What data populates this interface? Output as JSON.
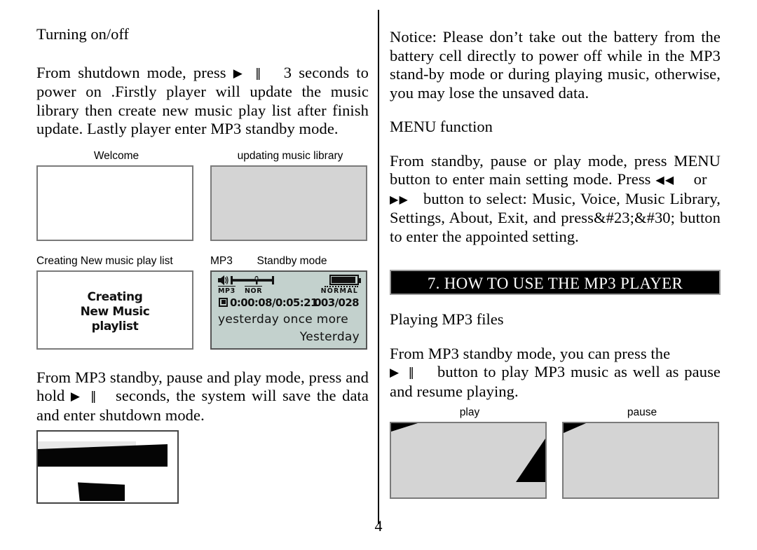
{
  "document": {
    "page_number": "4",
    "left_column": {
      "heading": "Turning on/off",
      "paragraph_1_part1": "From shutdown mode, press",
      "paragraph_1_glyph": "▶ ‖",
      "paragraph_1_part2": "3 seconds to power on .Firstly player will update the music library then create new   music play list after finish update. Lastly player enter MP3 standby mode.",
      "paragraph_2_part1": "From MP3 standby, pause and play mode, press and hold",
      "paragraph_2_glyph": "▶ ‖",
      "paragraph_2_part2": "seconds, the system will save the data and enter shutdown mode.",
      "figures": {
        "welcome_caption": "Welcome",
        "updating_caption": "updating music library",
        "creating_caption": "Creating New music play list",
        "standby_caption_left": "MP3",
        "standby_caption_right": "Standby mode",
        "creating_screen_line1": "Creating",
        "creating_screen_line2": "New Music",
        "creating_screen_line3": "playlist",
        "lcd": {
          "format_label": "MP3",
          "eq_label": "NOR",
          "battery_label": "NORMAL",
          "time_elapsed_total": "0:00:08/0:05:21",
          "track_counter": "003/028",
          "song_title": "yesterday once more",
          "song_artist": "Yesterday"
        }
      }
    },
    "right_column": {
      "notice_paragraph": "Notice: Please don’t take out the battery from the battery cell directly to power off while in the MP3 stand-by mode or during playing music, otherwise, you may lose the unsaved data.",
      "menu_heading": "MENU function",
      "menu_paragraph_part1": "From standby, pause or play mode, press MENU button to enter main setting mode. Press",
      "menu_glyph_prev": "◀◀",
      "menu_paragraph_or": "or",
      "menu_glyph_next": "▶▶",
      "menu_paragraph_part2": "button to select: Music, Voice, Music Library, Settings, About, Exit, and press&#23;&#30; button to enter the appointed setting.",
      "section_bar_title": "7. HOW TO USE THE MP3 PLAYER",
      "playing_heading": "Playing MP3 files",
      "playing_paragraph_part1": "From MP3 standby mode, you can press the",
      "playing_glyph": "▶ ‖",
      "playing_paragraph_part2": "button to play MP3 music as well as pause and resume playing.",
      "figures": {
        "play_caption": "play",
        "pause_caption": "pause"
      }
    }
  },
  "colors": {
    "lcd_background": "#c3d1cd",
    "screenshot_gray": "#d4d4d4",
    "section_bar_background": "#000000",
    "section_bar_text": "#ffffff",
    "frame_border": "#7a7a7a"
  }
}
